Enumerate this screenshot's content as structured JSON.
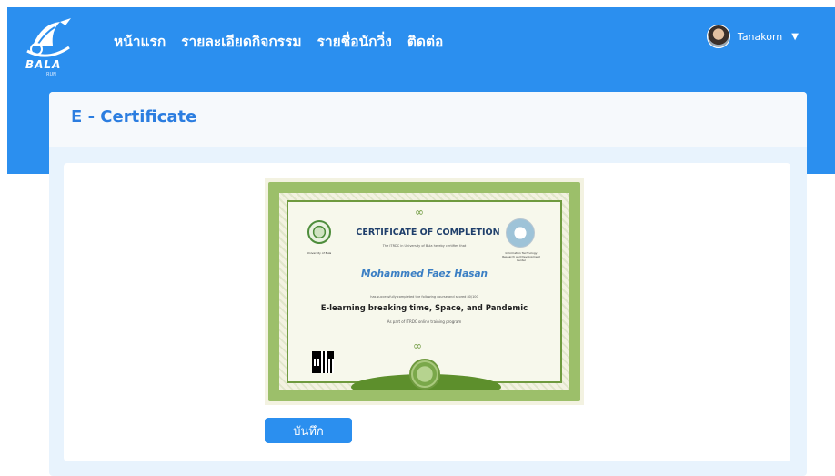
{
  "brand": {
    "name": "BALA",
    "sub": "RUN"
  },
  "nav": {
    "items": [
      {
        "label": "หน้าแรก"
      },
      {
        "label": "รายละเอียดกิจกรรม"
      },
      {
        "label": "รายชื่อนักวิ่ง"
      },
      {
        "label": "ติดต่อ"
      }
    ]
  },
  "user": {
    "name": "Tanakorn",
    "caret": "▼"
  },
  "page": {
    "title": "E - Certificate"
  },
  "certificate": {
    "heading": "CERTIFICATE OF COMPLETION",
    "sub": "The ITRDC in University of Bula hereby certifies that",
    "left_logo_caption": "University of Bula",
    "right_logo_caption": "Information Technology Research and Development Center",
    "name": "Mohammed Faez Hasan",
    "line1": "has successfully completed the following course and scored 80/100",
    "course": "E-learning breaking time, Space, and Pandemic",
    "line2": "As part of ITRDC online training program",
    "ornament": "∞"
  },
  "actions": {
    "save_label": "บันทึก"
  },
  "colors": {
    "primary": "#2b8fef",
    "title": "#2b7de0",
    "panel": "#e8f3fd"
  }
}
